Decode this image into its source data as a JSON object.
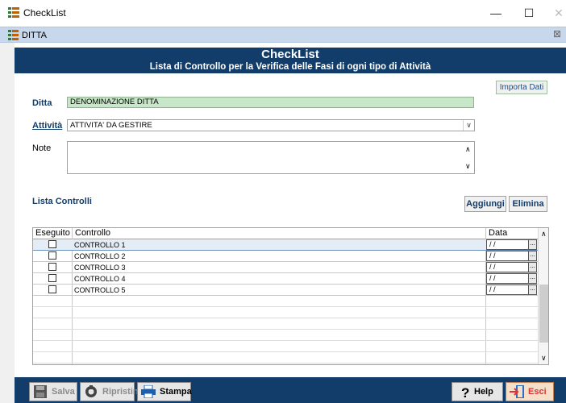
{
  "window": {
    "title": "CheckList",
    "minimize": "—",
    "maximize": "☐",
    "close": "✕"
  },
  "child_window": {
    "title": "DITTA",
    "close": "⊠"
  },
  "header": {
    "title": "CheckList",
    "subtitle": "Lista di Controllo per la Verifica delle Fasi di ogni tipo di Attività",
    "color": "#123d6b"
  },
  "form": {
    "import_button": "Importa Dati",
    "ditta_label": "Ditta",
    "ditta_value": "DENOMINAZIONE DITTA",
    "attivita_label": "Attività",
    "attivita_value": "ATTIVITA' DA GESTIRE",
    "note_label": "Note",
    "note_value": ""
  },
  "list": {
    "label": "Lista Controlli",
    "add_button": "Aggiungi",
    "delete_button": "Elimina",
    "columns": [
      "Eseguito",
      "Controllo",
      "Data"
    ],
    "rows": [
      {
        "done": false,
        "control": "CONTROLLO 1",
        "date": "/ /",
        "date_button": "..."
      },
      {
        "done": false,
        "control": "CONTROLLO 2",
        "date": "/ /",
        "date_button": "..."
      },
      {
        "done": false,
        "control": "CONTROLLO 3",
        "date": "/ /",
        "date_button": "..."
      },
      {
        "done": false,
        "control": "CONTROLLO 4",
        "date": "/ /",
        "date_button": "..."
      },
      {
        "done": false,
        "control": "CONTROLLO 5",
        "date": "/ /",
        "date_button": "..."
      }
    ]
  },
  "toolbar": {
    "save": "Salva",
    "reset": "Ripristina",
    "print": "Stampa",
    "help": "Help",
    "exit": "Esci"
  },
  "icons": {
    "app": "checklist-icon",
    "save": "floppy-disk-icon",
    "reset": "restore-icon",
    "print": "printer-icon",
    "help": "question-mark-icon",
    "exit": "exit-door-icon"
  }
}
